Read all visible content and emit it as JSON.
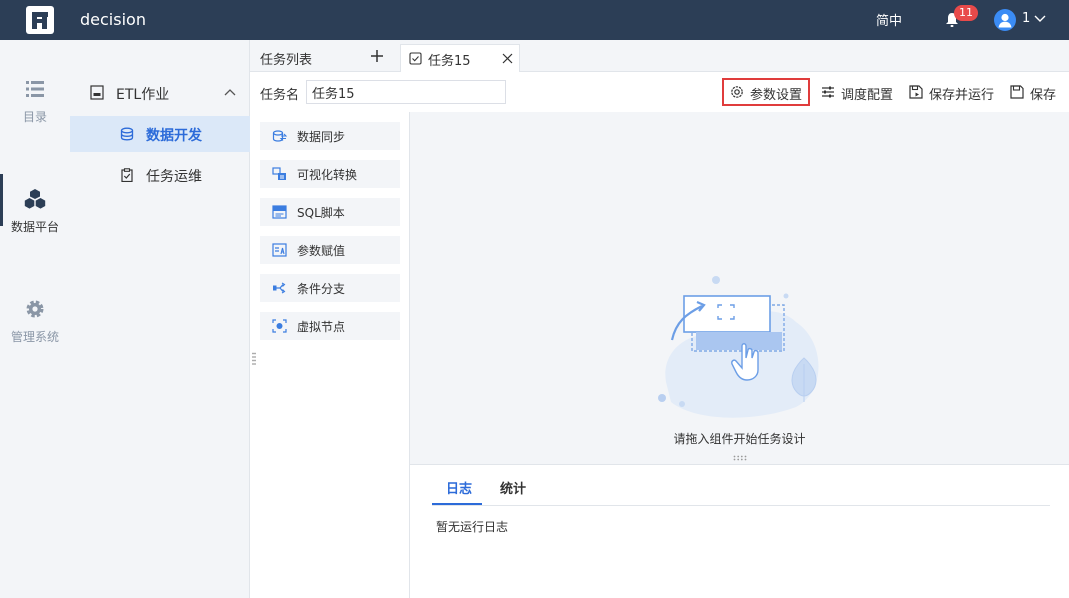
{
  "header": {
    "app_title": "decision",
    "language": "简中",
    "notification_count": "11",
    "user_name": "1"
  },
  "iconbar": {
    "items": [
      {
        "label": "目录",
        "icon": "list-icon"
      },
      {
        "label": "数据平台",
        "icon": "cubes-icon",
        "active": true
      },
      {
        "label": "管理系统",
        "icon": "gear-icon"
      }
    ]
  },
  "subnav": {
    "group_label": "ETL作业",
    "items": [
      {
        "label": "数据开发",
        "icon": "database-icon",
        "active": true
      },
      {
        "label": "任务运维",
        "icon": "clipboard-icon"
      }
    ]
  },
  "tabs": {
    "list_label": "任务列表",
    "active_tab_label": "任务15"
  },
  "task": {
    "name_label": "任务名",
    "name_value": "任务15"
  },
  "toolbar": {
    "param_settings": "参数设置",
    "schedule_config": "调度配置",
    "save_and_run": "保存并运行",
    "save": "保存"
  },
  "palette": {
    "items": [
      {
        "label": "数据同步",
        "icon": "data-sync-icon"
      },
      {
        "label": "可视化转换",
        "icon": "visual-transform-icon"
      },
      {
        "label": "SQL脚本",
        "icon": "sql-script-icon"
      },
      {
        "label": "参数赋值",
        "icon": "param-assign-icon"
      },
      {
        "label": "条件分支",
        "icon": "branch-icon"
      },
      {
        "label": "虚拟节点",
        "icon": "virtual-node-icon"
      }
    ]
  },
  "canvas": {
    "empty_hint": "请拖入组件开始任务设计"
  },
  "log": {
    "tabs": [
      "日志",
      "统计"
    ],
    "empty_text": "暂无运行日志"
  },
  "colors": {
    "header_bg": "#2c3e56",
    "accent": "#2c6bd9",
    "highlight_border": "#e03c3c",
    "badge": "#e84a4a"
  }
}
